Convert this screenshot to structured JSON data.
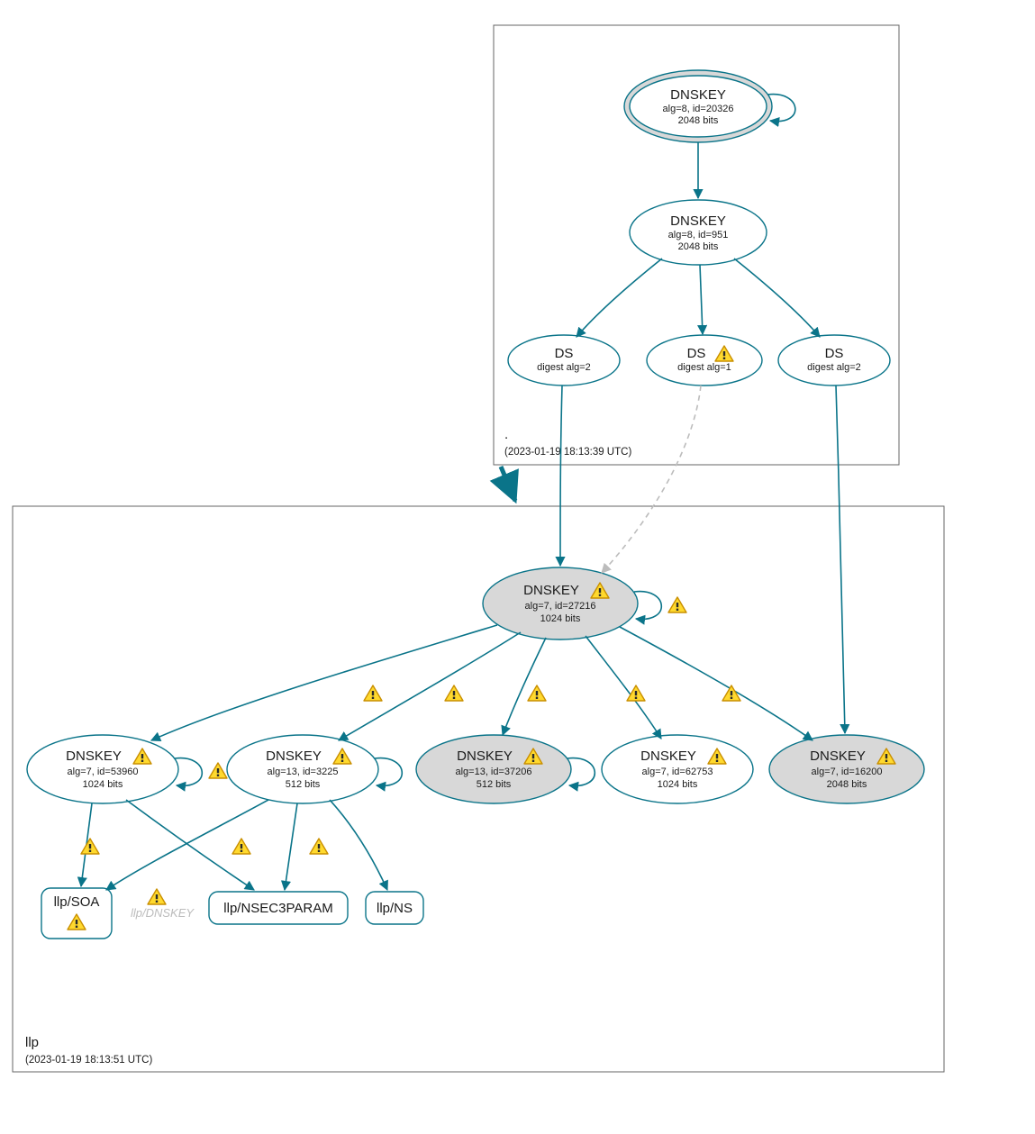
{
  "zones": {
    "root": {
      "label": ".",
      "timestamp": "(2023-01-19 18:13:39 UTC)"
    },
    "llp": {
      "label": "llp",
      "timestamp": "(2023-01-19 18:13:51 UTC)"
    }
  },
  "nodes": {
    "root_ksk": {
      "title": "DNSKEY",
      "line1": "alg=8, id=20326",
      "line2": "2048 bits",
      "warn": false
    },
    "root_zsk": {
      "title": "DNSKEY",
      "line1": "alg=8, id=951",
      "line2": "2048 bits",
      "warn": false
    },
    "ds_left": {
      "title": "DS",
      "line1": "digest alg=2",
      "line2": "",
      "warn": false
    },
    "ds_mid": {
      "title": "DS",
      "line1": "digest alg=1",
      "line2": "",
      "warn": true
    },
    "ds_right": {
      "title": "DS",
      "line1": "digest alg=2",
      "line2": "",
      "warn": false
    },
    "llp_ksk": {
      "title": "DNSKEY",
      "line1": "alg=7, id=27216",
      "line2": "1024 bits",
      "warn": true
    },
    "llp_53960": {
      "title": "DNSKEY",
      "line1": "alg=7, id=53960",
      "line2": "1024 bits",
      "warn": true
    },
    "llp_3225": {
      "title": "DNSKEY",
      "line1": "alg=13, id=3225",
      "line2": "512 bits",
      "warn": true
    },
    "llp_37206": {
      "title": "DNSKEY",
      "line1": "alg=13, id=37206",
      "line2": "512 bits",
      "warn": true
    },
    "llp_62753": {
      "title": "DNSKEY",
      "line1": "alg=7, id=62753",
      "line2": "1024 bits",
      "warn": true
    },
    "llp_16200": {
      "title": "DNSKEY",
      "line1": "alg=7, id=16200",
      "line2": "2048 bits",
      "warn": true
    }
  },
  "rrsets": {
    "soa": {
      "label": "llp/SOA",
      "warn": true
    },
    "dnskey": {
      "label": "llp/DNSKEY",
      "ghost": true
    },
    "nsec3param": {
      "label": "llp/NSEC3PARAM",
      "warn": false
    },
    "ns": {
      "label": "llp/NS",
      "warn": false
    }
  },
  "colors": {
    "stroke": "#0a7489",
    "fill_gray": "#d8d8d8",
    "warn_fill": "#ffd92e",
    "warn_stroke": "#c98f00"
  }
}
